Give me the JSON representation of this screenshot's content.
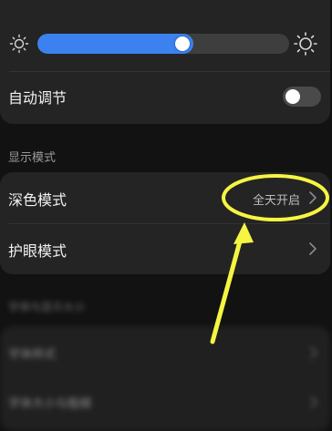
{
  "brightness": {
    "level": 0.62,
    "auto_adjust_label": "自动调节",
    "auto_adjust_on": false
  },
  "display": {
    "section_label": "显示模式",
    "dark_mode": {
      "label": "深色模式",
      "value": "全天开启"
    },
    "eye_care": {
      "label": "护眼模式"
    }
  },
  "blurred": {
    "section_label": "字体与显示大小",
    "rows": [
      "字体样式",
      "字体大小与粗细"
    ]
  },
  "colors": {
    "accent": "#3b82f0",
    "annotation": "#f5f542"
  },
  "icons": {
    "brightness_low": "sun-small-icon",
    "brightness_high": "sun-large-icon",
    "chevron": "chevron-right-icon"
  }
}
